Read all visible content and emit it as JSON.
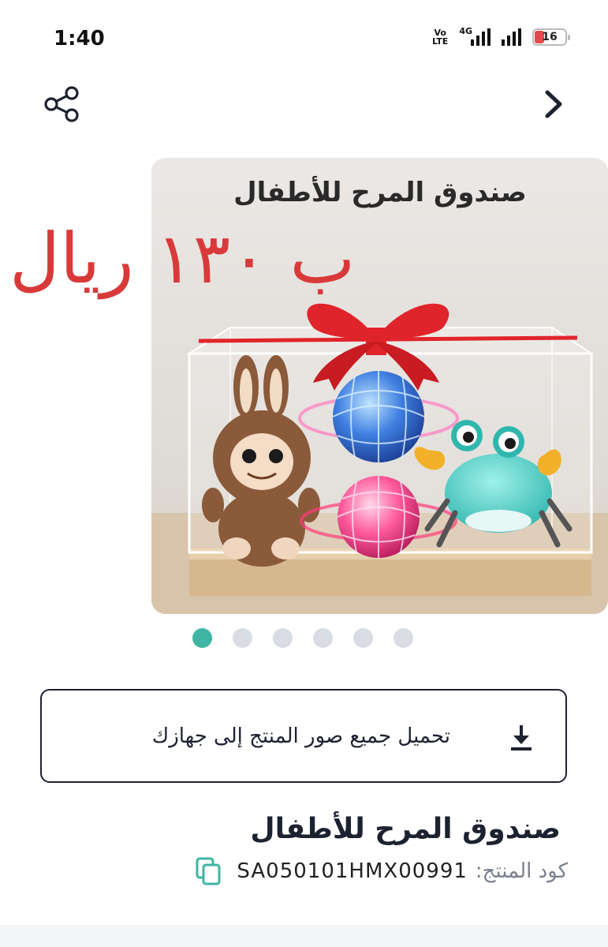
{
  "status_bar": {
    "time": "1:40",
    "volte_top": "Vo",
    "volte_bottom": "LTE",
    "network": "4G",
    "battery": "16"
  },
  "header": {
    "share_icon": "share-icon",
    "forward_icon": "chevron-right-icon"
  },
  "image": {
    "title_text": "صندوق المرح للأطفال",
    "price_overlay": "ب ١٣٠ ريال"
  },
  "carousel": {
    "total": 6,
    "active_index": 0
  },
  "download": {
    "label": "تحميل جميع صور المنتج إلى جهازك",
    "icon": "download-icon"
  },
  "product": {
    "title": "صندوق المرح للأطفال",
    "code_label": "كود المنتج:",
    "code_value": "SA050101HMX00991",
    "copy_icon": "copy-icon"
  },
  "colors": {
    "accent": "#3fb5a3",
    "price_red": "#d83a3a",
    "text_dark": "#1d2230",
    "muted": "#7b818c"
  }
}
